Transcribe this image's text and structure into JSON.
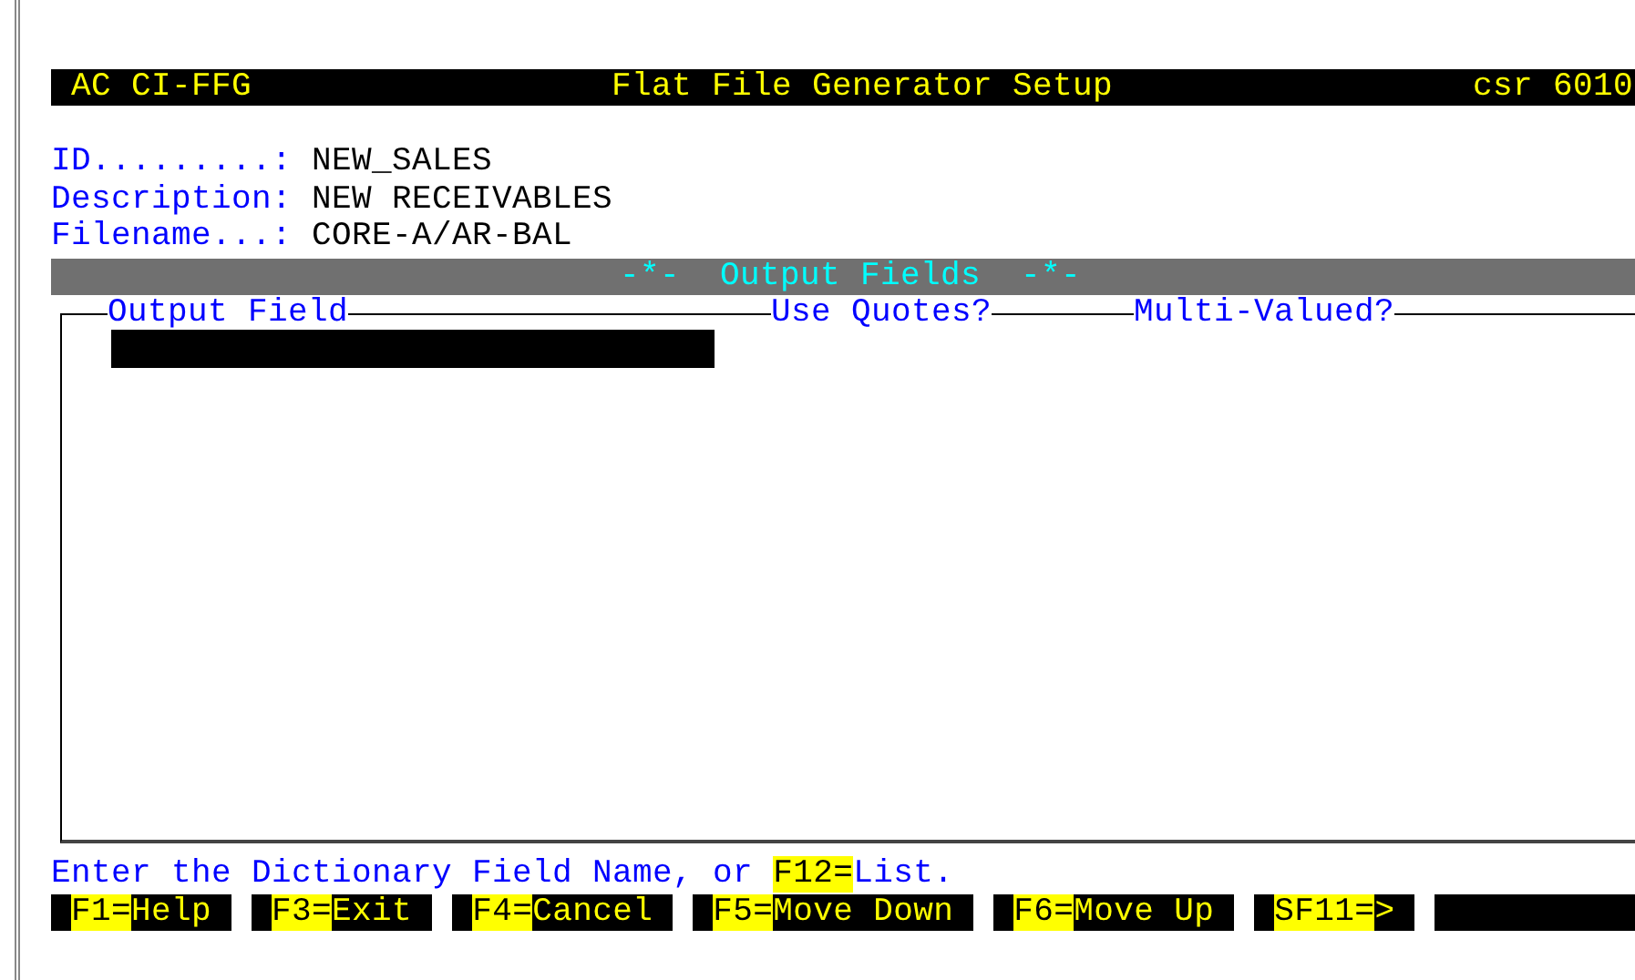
{
  "title_bar": {
    "left": "AC CI-FFG",
    "center": "Flat File Generator Setup",
    "right": "csr 6010"
  },
  "fields": [
    {
      "label": "ID.........:",
      "value": "NEW_SALES"
    },
    {
      "label": "Description:",
      "value": "NEW RECEIVABLES"
    },
    {
      "label": "Filename...:",
      "value": "CORE-A/AR-BAL"
    }
  ],
  "section_title": "-*-  Output Fields  -*-",
  "table": {
    "columns": [
      "Output Field",
      "Use Quotes?",
      "Multi-Valued?"
    ]
  },
  "prompt": [
    {
      "kind": "plain",
      "text": "Enter the Dictionary Field Name, or "
    },
    {
      "kind": "key",
      "text": "F12="
    },
    {
      "kind": "plain",
      "text": "List."
    }
  ],
  "function_keys": [
    {
      "key": "F1=",
      "label": "Help"
    },
    {
      "key": "F3=",
      "label": "Exit"
    },
    {
      "key": "F4=",
      "label": "Cancel"
    },
    {
      "key": "F5=",
      "label": "Move Down"
    },
    {
      "key": "F6=",
      "label": "Move Up"
    },
    {
      "key": "SF11=",
      "label": ">"
    }
  ]
}
